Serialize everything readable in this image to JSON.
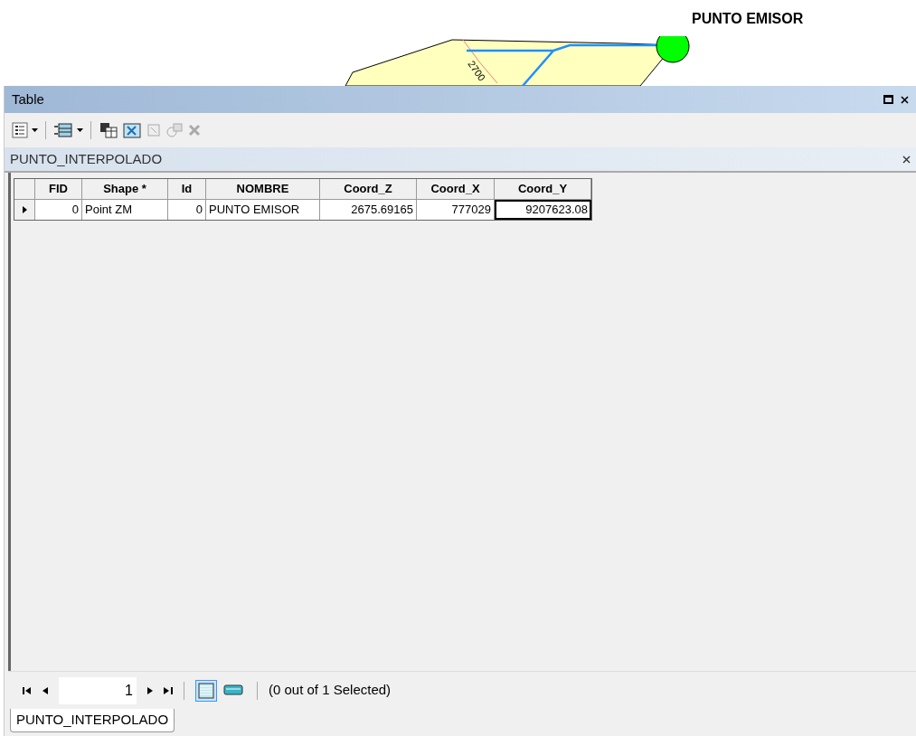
{
  "map": {
    "point_label": "PUNTO EMISOR",
    "contour_label": "2700"
  },
  "window": {
    "title": "Table"
  },
  "table_tab": {
    "title": "PUNTO_INTERPOLADO"
  },
  "table": {
    "columns": [
      {
        "label": "FID",
        "kind": "number"
      },
      {
        "label": "Shape *",
        "kind": "text"
      },
      {
        "label": "Id",
        "kind": "number"
      },
      {
        "label": "NOMBRE",
        "kind": "text"
      },
      {
        "label": "Coord_Z",
        "kind": "number"
      },
      {
        "label": "Coord_X",
        "kind": "number"
      },
      {
        "label": "Coord_Y",
        "kind": "number"
      }
    ],
    "rows": [
      {
        "current": true,
        "cells": [
          "0",
          "Point ZM",
          "0",
          "PUNTO EMISOR",
          "2675.69165",
          "777029",
          "9207623.08"
        ]
      }
    ]
  },
  "navigator": {
    "record": "1",
    "status": "(0 out of 1 Selected)",
    "views": [
      {
        "kind": "all",
        "selected": true
      },
      {
        "kind": "selected",
        "selected": false
      }
    ]
  },
  "bottom_tabs": [
    {
      "label": "PUNTO_INTERPOLADO",
      "selected": true
    }
  ]
}
